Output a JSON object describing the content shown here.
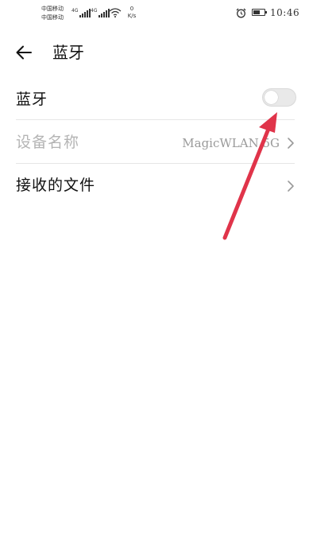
{
  "status_bar": {
    "carrier_1": "中国移动",
    "carrier_2": "中国移动",
    "sim1_tag": "4G",
    "sim2_tag": "4G",
    "speed_value": "0",
    "speed_unit": "K/s",
    "time": "10:46"
  },
  "header": {
    "title": "蓝牙",
    "back_icon": "arrow-left-icon"
  },
  "settings": {
    "bluetooth": {
      "label": "蓝牙",
      "enabled": false
    },
    "device_name": {
      "label": "设备名称",
      "value": "MagicWLAN 5G"
    },
    "received_files": {
      "label": "接收的文件"
    }
  },
  "colors": {
    "annotation_arrow": "#e0344a",
    "toggle_off": "#e9e9e9",
    "disabled_text": "#b4b4b4"
  }
}
